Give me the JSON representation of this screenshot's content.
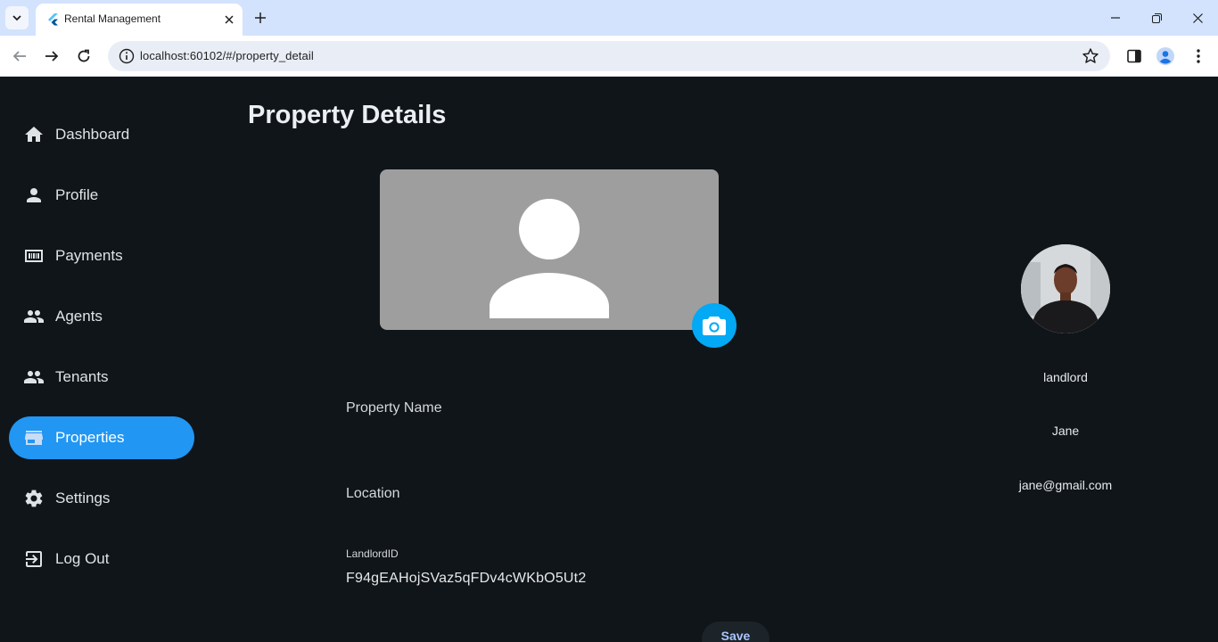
{
  "browser": {
    "tab_title": "Rental Management",
    "url": "localhost:60102/#/property_detail",
    "icons": {
      "tab_search": "chevron-down-icon",
      "favicon": "flutter-icon",
      "tab_close": "close-icon",
      "new_tab": "plus-icon",
      "minimize": "minimize-icon",
      "restore": "restore-icon",
      "close_window": "close-icon",
      "back": "arrow-left-icon",
      "forward": "arrow-right-icon",
      "reload": "reload-icon",
      "site_info": "info-icon",
      "bookmark": "star-icon",
      "side_panel": "side-panel-icon",
      "profile": "account-icon",
      "menu": "kebab-menu-icon"
    }
  },
  "sidebar": {
    "items": [
      {
        "label": "Dashboard",
        "icon": "home-icon",
        "active": false
      },
      {
        "label": "Profile",
        "icon": "person-icon",
        "active": false
      },
      {
        "label": "Payments",
        "icon": "payments-icon",
        "active": false
      },
      {
        "label": "Agents",
        "icon": "people-icon",
        "active": false
      },
      {
        "label": "Tenants",
        "icon": "people-icon",
        "active": false
      },
      {
        "label": "Properties",
        "icon": "store-icon",
        "active": true
      },
      {
        "label": "Settings",
        "icon": "gear-icon",
        "active": false
      },
      {
        "label": "Log Out",
        "icon": "logout-icon",
        "active": false
      }
    ],
    "active_color": "#2196f3"
  },
  "main": {
    "title": "Property Details",
    "photo_placeholder_icon": "person-placeholder-icon",
    "camera_icon": "camera-icon",
    "property_name_label": "Property Name",
    "location_label": "Location",
    "landlord_id_label": "LandlordID",
    "landlord_id_value": "F94gEAHojSVaz5qFDv4cWKbO5Ut2",
    "save_label": "Save"
  },
  "user_panel": {
    "role": "landlord",
    "name": "Jane",
    "email": "jane@gmail.com"
  },
  "colors": {
    "background": "#0f1519",
    "accent": "#2196f3",
    "camera_button": "#03a9f4",
    "photo_placeholder": "#9e9e9e"
  }
}
